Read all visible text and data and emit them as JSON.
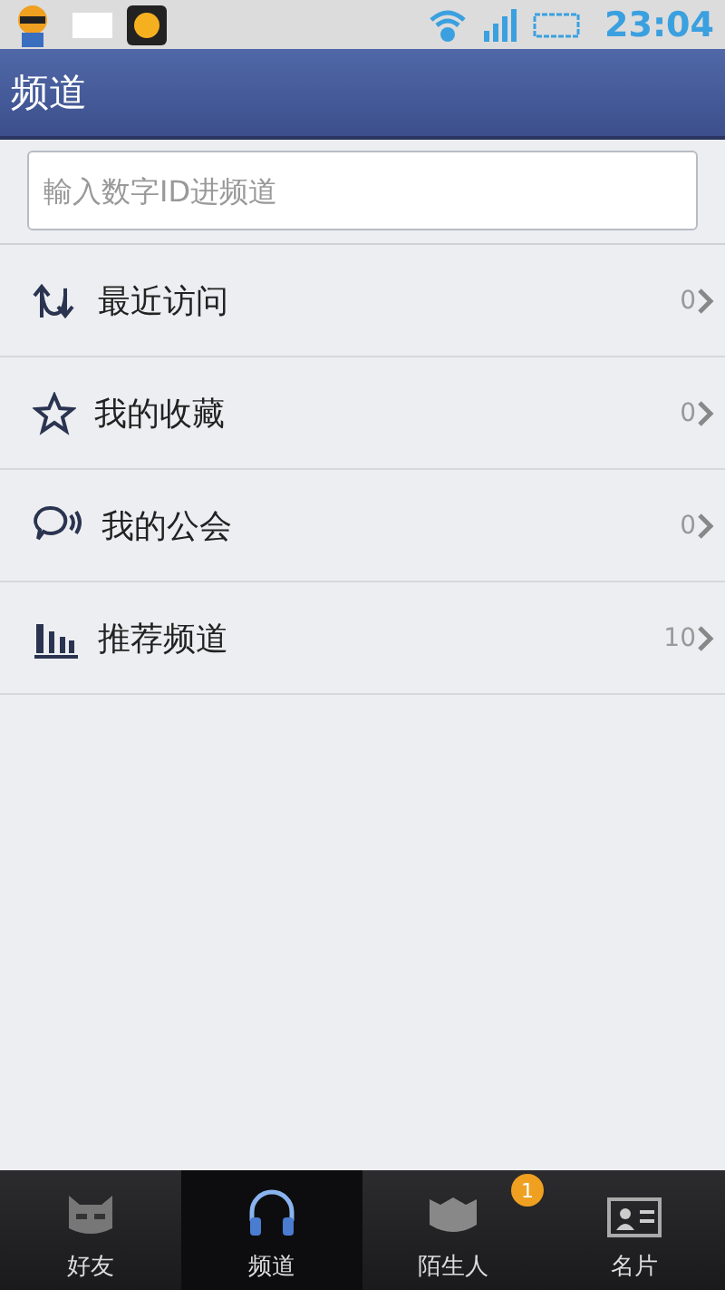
{
  "status_bar": {
    "time": "23:04"
  },
  "title_bar": {
    "title": "频道"
  },
  "search": {
    "placeholder": "輸入数字ID进频道"
  },
  "list": [
    {
      "kind": "recent",
      "label": "最近访问",
      "count": "0"
    },
    {
      "kind": "star",
      "label": "我的收藏",
      "count": "0"
    },
    {
      "kind": "guild",
      "label": "我的公会",
      "count": "0"
    },
    {
      "kind": "chart",
      "label": "推荐频道",
      "count": "10"
    }
  ],
  "tabs": [
    {
      "kind": "friends",
      "label": "好友",
      "selected": false
    },
    {
      "kind": "channel",
      "label": "频道",
      "selected": true
    },
    {
      "kind": "strangers",
      "label": "陌生人",
      "selected": false,
      "badge": "1"
    },
    {
      "kind": "card",
      "label": "名片",
      "selected": false
    }
  ]
}
